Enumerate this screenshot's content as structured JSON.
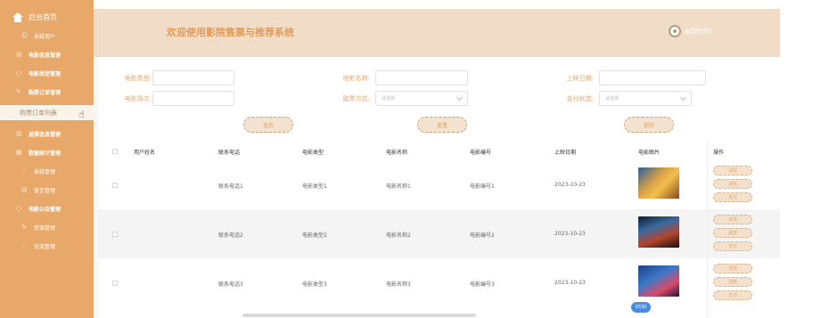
{
  "sidebar": {
    "home_label": "后台首页",
    "items": [
      {
        "label": "系统用户",
        "icon": "user-icon"
      },
      {
        "label": "电影信息管理",
        "icon": "grid-icon"
      },
      {
        "label": "电影类型管理",
        "icon": "search-icon"
      },
      {
        "label": "购票订单管理",
        "icon": "edit-icon"
      },
      {
        "label": "购票订单列表",
        "icon": ""
      },
      {
        "label": "退票信息管理",
        "icon": "grid-icon"
      },
      {
        "label": "数据统计管理",
        "icon": "chart-icon"
      },
      {
        "label": "系统管理",
        "icon": "heart-icon"
      },
      {
        "label": "留言管理",
        "icon": "grid-icon"
      },
      {
        "label": "电影公告管理",
        "icon": "search-icon"
      },
      {
        "label": "资源管理",
        "icon": "edit-icon"
      },
      {
        "label": "交流管理",
        "icon": "heart-icon"
      }
    ],
    "active_label": "购票订单列表",
    "accent": "#e8a86a"
  },
  "header": {
    "title": "欢迎使用影院售票与推荐系统",
    "user": "admin"
  },
  "filters": {
    "movie_type_label": "电影类型:",
    "movie_name_label": "电影名称:",
    "release_date_label": "上映日期:",
    "showing_label": "电影场次:",
    "buy_method_label": "取票方式:",
    "buy_method_placeholder": "请选择",
    "pay_status_label": "支付状态:",
    "pay_status_placeholder": "请选择",
    "search_button": "查询",
    "reset_button": "重置",
    "delete_button": "删除"
  },
  "table": {
    "headers": [
      "用户姓名",
      "联系电话",
      "电影类型",
      "电影名称",
      "电影编号",
      "上映日期",
      "电影图片",
      "操作"
    ],
    "rows": [
      {
        "name": "",
        "phone": "联系电话1",
        "type": "电影类型1",
        "title": "电影名称1",
        "code": "电影编号1",
        "date": "2023-10-23"
      },
      {
        "name": "",
        "phone": "联系电话2",
        "type": "电影类型2",
        "title": "电影名称2",
        "code": "电影编号2",
        "date": "2023-10-23"
      },
      {
        "name": "",
        "phone": "联系电话3",
        "type": "电影类型3",
        "title": "电影名称3",
        "code": "电影编号3",
        "date": "2023-10-23"
      }
    ],
    "actions": [
      "详情",
      "退款",
      "支付"
    ]
  },
  "badge_text": "0330"
}
